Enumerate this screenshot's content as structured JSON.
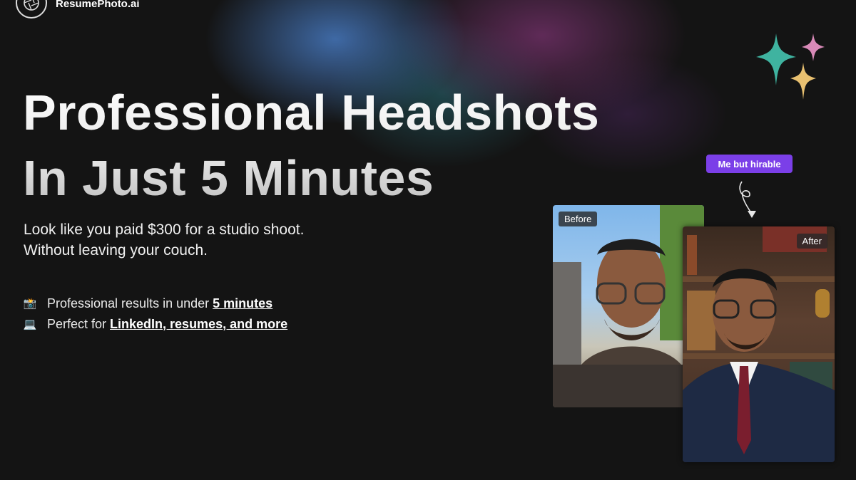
{
  "brand": {
    "name": "ResumePhoto.ai"
  },
  "hero": {
    "title_line1": "Professional Headshots",
    "title_line2": "In Just 5 Minutes",
    "subtitle_line1": "Look like you paid $300 for a studio shoot.",
    "subtitle_line2": "Without leaving your couch."
  },
  "features": [
    {
      "icon": "📸",
      "icon_name": "camera-icon",
      "text": "Professional results in under ",
      "link": "5 minutes"
    },
    {
      "icon": "💻",
      "icon_name": "laptop-icon",
      "text": "Perfect for ",
      "link": "LinkedIn, resumes, and more"
    }
  ],
  "comparison": {
    "tag": "Me but hirable",
    "before_label": "Before",
    "after_label": "After"
  },
  "colors": {
    "background": "#141414",
    "tag_purple": "#7b3fe8",
    "sparkle_teal": "#3fb3a0",
    "sparkle_pink": "#d98ab8",
    "sparkle_gold": "#e8c070"
  }
}
